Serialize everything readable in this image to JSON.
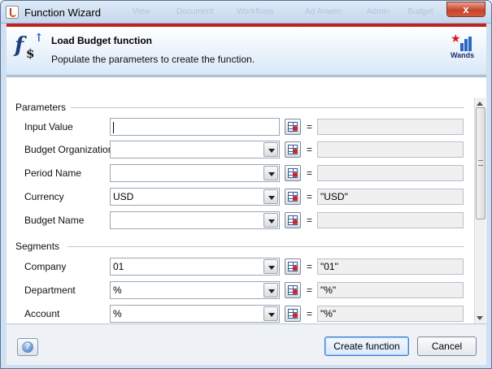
{
  "window": {
    "title": "Function Wizard",
    "close_label": "x",
    "background_menu_hints": [
      "View",
      "Document",
      "Workflows",
      "Ad Anwen",
      "Admin",
      "Budget"
    ]
  },
  "header": {
    "title": "Load Budget function",
    "subtitle": "Populate the parameters to create the function.",
    "brand_label": "Wands",
    "accent_color": "#c0221f"
  },
  "sections": {
    "parameters": {
      "title": "Parameters",
      "rows": [
        {
          "label": "Input Value",
          "kind": "text",
          "value": "",
          "result": ""
        },
        {
          "label": "Budget Organization",
          "kind": "combo",
          "value": "",
          "result": ""
        },
        {
          "label": "Period Name",
          "kind": "combo",
          "value": "",
          "result": ""
        },
        {
          "label": "Currency",
          "kind": "combo",
          "value": "USD",
          "result": "\"USD\""
        },
        {
          "label": "Budget Name",
          "kind": "combo",
          "value": "",
          "result": ""
        }
      ]
    },
    "segments": {
      "title": "Segments",
      "rows": [
        {
          "label": "Company",
          "kind": "combo",
          "value": "01",
          "result": "\"01\""
        },
        {
          "label": "Department",
          "kind": "combo",
          "value": "%",
          "result": "\"%\""
        },
        {
          "label": "Account",
          "kind": "combo",
          "value": "%",
          "result": "\"%\""
        }
      ]
    }
  },
  "equals_sign": "=",
  "footer": {
    "create_label": "Create function",
    "cancel_label": "Cancel"
  }
}
